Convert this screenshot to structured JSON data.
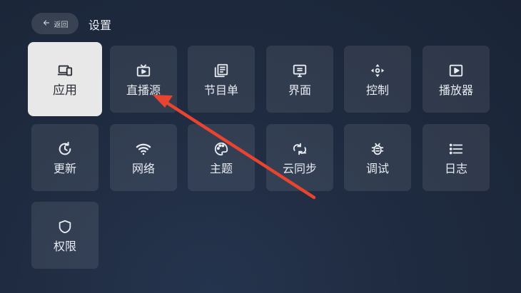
{
  "header": {
    "back_label": "返回",
    "title": "设置"
  },
  "tiles": [
    {
      "label": "应用",
      "icon": "devices-icon",
      "selected": true
    },
    {
      "label": "直播源",
      "icon": "tv-icon"
    },
    {
      "label": "节目单",
      "icon": "list-document-icon"
    },
    {
      "label": "界面",
      "icon": "screen-icon"
    },
    {
      "label": "控制",
      "icon": "dpad-icon"
    },
    {
      "label": "播放器",
      "icon": "play-icon"
    },
    {
      "label": "更新",
      "icon": "refresh-icon"
    },
    {
      "label": "网络",
      "icon": "wifi-icon"
    },
    {
      "label": "主题",
      "icon": "palette-icon"
    },
    {
      "label": "云同步",
      "icon": "cloud-sync-icon"
    },
    {
      "label": "调试",
      "icon": "bug-icon"
    },
    {
      "label": "日志",
      "icon": "list-icon"
    },
    {
      "label": "权限",
      "icon": "shield-icon"
    }
  ],
  "annotation": {
    "arrow_color": "#e8442f"
  }
}
